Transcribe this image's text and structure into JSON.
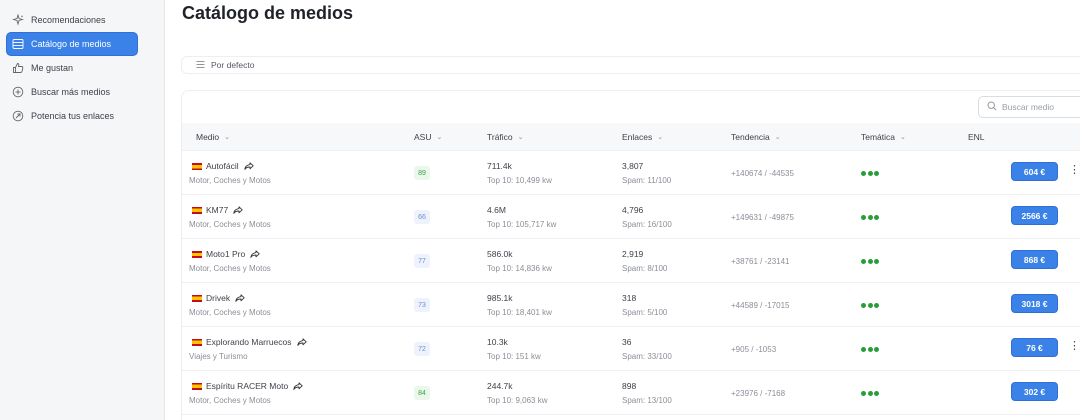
{
  "sidebar": {
    "items": [
      {
        "label": "Recomendaciones",
        "icon": "sparkles-icon",
        "active": false
      },
      {
        "label": "Catálogo de medios",
        "icon": "list-icon",
        "active": true
      },
      {
        "label": "Me gustan",
        "icon": "thumbs-up-icon",
        "active": false
      },
      {
        "label": "Buscar más medios",
        "icon": "plus-circle-icon",
        "active": false
      },
      {
        "label": "Potencia tus enlaces",
        "icon": "rocket-icon",
        "active": false
      }
    ]
  },
  "page": {
    "title": "Catálogo de medios"
  },
  "sort": {
    "label": "Por defecto"
  },
  "search": {
    "placeholder": "Buscar medio"
  },
  "table": {
    "headers": {
      "medio": "Medio",
      "asu": "ASU",
      "trafico": "Tráfico",
      "enlaces": "Enlaces",
      "tendencia": "Tendencia",
      "tematica": "Temática",
      "enl": "ENL"
    },
    "rows": [
      {
        "name": "Autofácil",
        "category": "Motor, Coches y Motos",
        "asu": "89",
        "asu_color": "green",
        "traffic": "711.4k",
        "top10": "Top 10: 10,499 kw",
        "links": "3,807",
        "spam": "Spam: 11/100",
        "trend": "+140674 / -44535",
        "price": "604 €",
        "has_more": true
      },
      {
        "name": "KM77",
        "category": "Motor, Coches y Motos",
        "asu": "66",
        "asu_color": "blue",
        "traffic": "4.6M",
        "top10": "Top 10: 105,717 kw",
        "links": "4,796",
        "spam": "Spam: 16/100",
        "trend": "+149631 / -49875",
        "price": "2566 €",
        "has_more": false
      },
      {
        "name": "Moto1 Pro",
        "category": "Motor, Coches y Motos",
        "asu": "77",
        "asu_color": "blue",
        "traffic": "586.0k",
        "top10": "Top 10: 14,836 kw",
        "links": "2,919",
        "spam": "Spam: 8/100",
        "trend": "+38761 / -23141",
        "price": "868 €",
        "has_more": false
      },
      {
        "name": "Drivek",
        "category": "Motor, Coches y Motos",
        "asu": "73",
        "asu_color": "blue",
        "traffic": "985.1k",
        "top10": "Top 10: 18,401 kw",
        "links": "318",
        "spam": "Spam: 5/100",
        "trend": "+44589 / -17015",
        "price": "3018 €",
        "has_more": false
      },
      {
        "name": "Explorando Marruecos",
        "category": "Viajes y Turismo",
        "asu": "72",
        "asu_color": "blue",
        "traffic": "10.3k",
        "top10": "Top 10: 151 kw",
        "links": "36",
        "spam": "Spam: 33/100",
        "trend": "+905 / -1053",
        "price": "76 €",
        "has_more": true
      },
      {
        "name": "Espíritu RACER Moto",
        "category": "Motor, Coches y Motos",
        "asu": "84",
        "asu_color": "green",
        "traffic": "244.7k",
        "top10": "Top 10: 9,063 kw",
        "links": "898",
        "spam": "Spam: 13/100",
        "trend": "+23976 / -7168",
        "price": "302 €",
        "has_more": false
      }
    ]
  },
  "colors": {
    "accent": "#3b82e8",
    "dots": "#2a9d3a"
  }
}
